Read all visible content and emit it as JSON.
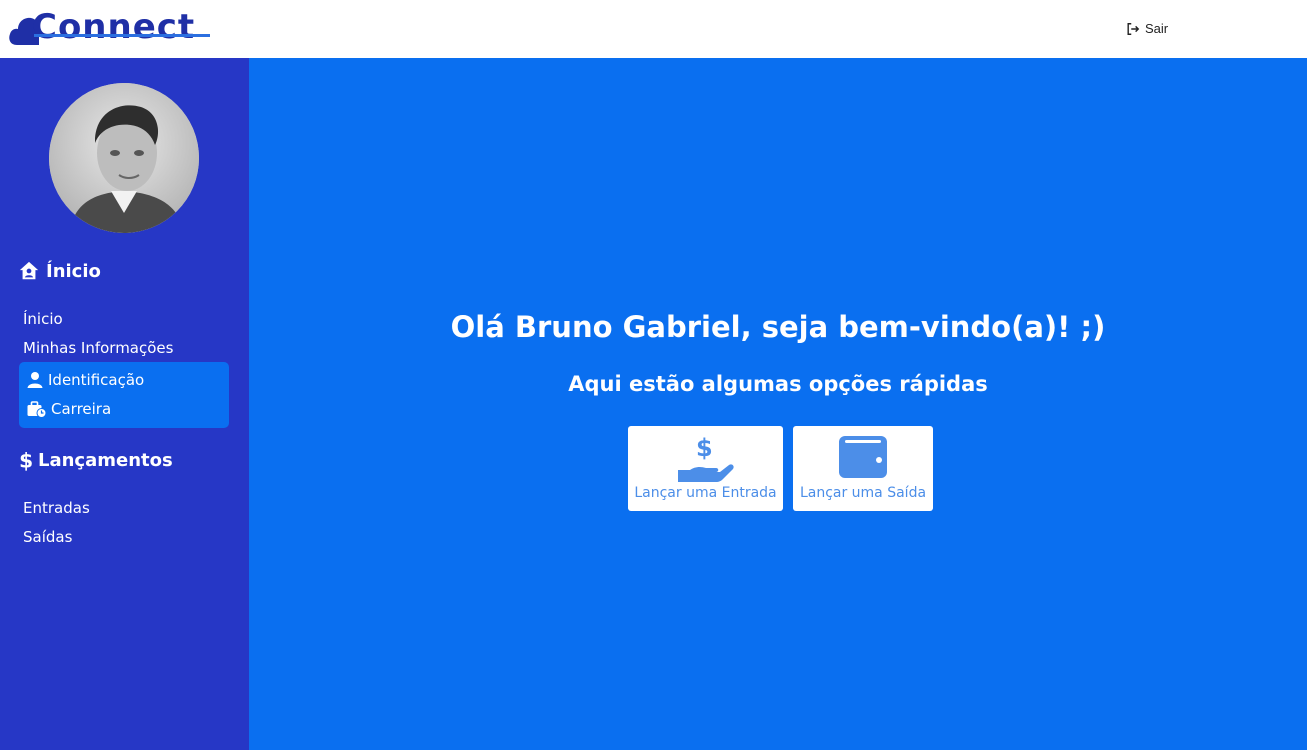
{
  "header": {
    "brand": "Connect",
    "logout_label": "Sair",
    "logout_icon": "sign-out-icon"
  },
  "sidebar": {
    "avatar": "user-photo",
    "sections": [
      {
        "title": "Ínicio",
        "icon": "house-user-icon",
        "links": [
          "Ínicio",
          "Minhas Informações"
        ],
        "submenu": [
          {
            "label": "Identificação",
            "icon": "user-icon"
          },
          {
            "label": "Carreira",
            "icon": "briefcase-clock-icon"
          }
        ]
      },
      {
        "title": "Lançamentos",
        "icon": "dollar-icon",
        "links": [
          "Entradas",
          "Saídas"
        ]
      }
    ]
  },
  "main": {
    "greeting": "Olá Bruno Gabriel, seja bem-vindo(a)! ;)",
    "subtitle": "Aqui estão algumas opções rápidas",
    "quick_actions": [
      {
        "label": "Lançar uma Entrada",
        "icon": "hand-holding-dollar-icon"
      },
      {
        "label": "Lançar uma Saída",
        "icon": "wallet-icon"
      }
    ]
  },
  "colors": {
    "sidebar_bg": "#2637c6",
    "main_bg": "#0a6ff0",
    "accent_icon": "#4c8ee8",
    "brand": "#1f2fa6"
  }
}
